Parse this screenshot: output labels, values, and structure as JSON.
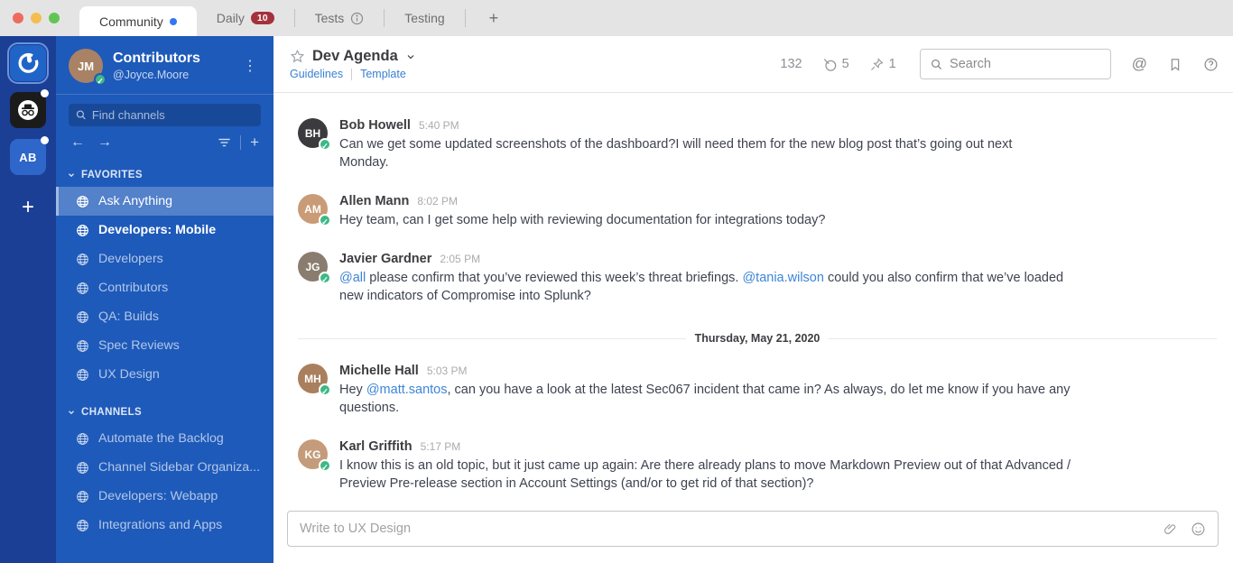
{
  "topbar": {
    "traffic_lights": [
      "#EE6A5F",
      "#F5BD4F",
      "#61C554"
    ],
    "tabs": [
      {
        "label": "Community",
        "active": true,
        "has_unread_dot": true
      },
      {
        "label": "Daily",
        "badge": "10"
      },
      {
        "label": "Tests",
        "has_info_icon": true
      },
      {
        "label": "Testing"
      }
    ],
    "new_tab_label": "+"
  },
  "rail": {
    "ab_team_label": "AB",
    "add_team_label": "+"
  },
  "icons": {
    "kebab": "⋮",
    "back_arrow": "←",
    "forward_arrow": "→",
    "plus": "+",
    "at": "@",
    "check": "✓"
  },
  "sidebar": {
    "team_name": "Contributors",
    "user_handle": "@Joyce.Moore",
    "user_initials": "JM",
    "user_avatar_color": "#A98265",
    "search_placeholder": "Find channels",
    "sections": [
      {
        "label": "FAVORITES",
        "items": [
          "Ask Anything",
          "Developers: Mobile",
          "Developers",
          "Contributors",
          "QA: Builds",
          "Spec Reviews",
          "UX Design"
        ]
      },
      {
        "label": "CHANNELS",
        "items": [
          "Automate the Backlog",
          "Channel Sidebar Organiza...",
          "Developers: Webapp",
          "Integrations and Apps"
        ]
      }
    ]
  },
  "header": {
    "channel_name": "Dev Agenda",
    "link_guidelines": "Guidelines",
    "link_template": "Template",
    "member_count": "132",
    "muted_count": "5",
    "pinned_count": "1",
    "search_placeholder": "Search"
  },
  "conversation": {
    "date_divider": "Thursday, May 21, 2020",
    "messages": [
      {
        "author": "Bob Howell",
        "initials": "BH",
        "avatar_color": "#3B3B3E",
        "time": "5:40 PM",
        "line1": "Can we get some updated screenshots of the dashboard?I will need them for the new blog post that’s going out next",
        "line2": "Monday."
      },
      {
        "author": "Allen Mann",
        "initials": "AM",
        "avatar_color": "#C99B76",
        "time": "8:02 PM",
        "line1": "Hey team, can I get some help with reviewing documentation for integrations today?"
      },
      {
        "author": "Javier Gardner",
        "initials": "JG",
        "avatar_color": "#8A7D6F",
        "time": "2:05 PM",
        "link1": "@all",
        "text1": " please confirm that you’ve reviewed this week’s threat briefings. ",
        "link2": "@tania.wilson",
        "text2": " could you also confirm that we’ve loaded",
        "line2": "new indicators of Compromise into Splunk?"
      },
      {
        "author": "Michelle Hall",
        "initials": "MH",
        "avatar_color": "#A97F5E",
        "time": "5:03 PM",
        "text1": "Hey ",
        "link1": "@matt.santos",
        "text2": ", can you have a look at the latest Sec067 incident that came in? As always, do let me know if you have any",
        "line2": "questions."
      },
      {
        "author": "Karl Griffith",
        "initials": "KG",
        "avatar_color": "#C49C7B",
        "time": "5:17 PM",
        "line1": "I know this is an old topic, but it just came up again: Are there already plans to move Markdown Preview out of that Advanced /",
        "line2": "Preview Pre-release section in Account Settings (and/or to get rid of that section)?"
      }
    ]
  },
  "composer": {
    "placeholder": "Write to UX Design"
  }
}
